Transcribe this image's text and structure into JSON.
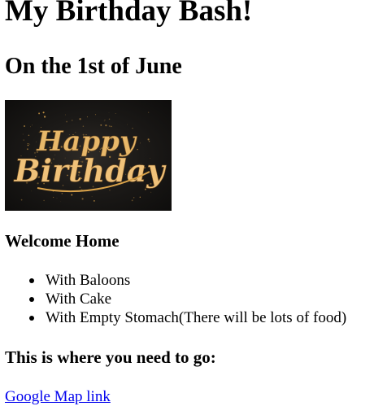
{
  "page": {
    "title": "My Birthday Bash!",
    "subtitle": "On the 1st of June"
  },
  "banner": {
    "line1": "Happy",
    "line2": "Birthday",
    "colors": {
      "background": "#1c1a18",
      "text": "#e8b86a",
      "sparkle": "#d9a24a"
    }
  },
  "welcome": {
    "heading": "Welcome Home",
    "items": [
      {
        "label": "With Baloons"
      },
      {
        "label": "With Cake"
      },
      {
        "label": "With Empty Stomach(There will be lots of food)"
      }
    ]
  },
  "directions": {
    "heading": "This is where you need to go:",
    "link_label": "Google Map link",
    "link_color": "#0000ee"
  }
}
